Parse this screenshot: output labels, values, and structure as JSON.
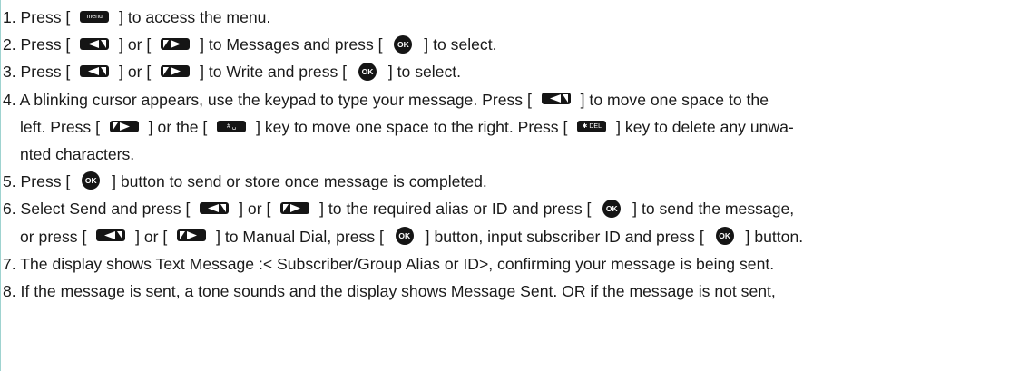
{
  "steps": [
    {
      "lines": [
        [
          {
            "t": "1. Press [ "
          },
          {
            "k": "menu"
          },
          {
            "t": " ] to access the menu."
          }
        ]
      ]
    },
    {
      "lines": [
        [
          {
            "t": "2. Press [ "
          },
          {
            "k": "left"
          },
          {
            "t": " ] or [ "
          },
          {
            "k": "right"
          },
          {
            "t": " ] to Messages and press [ "
          },
          {
            "k": "ok"
          },
          {
            "t": " ] to select."
          }
        ]
      ]
    },
    {
      "lines": [
        [
          {
            "t": "3. Press [ "
          },
          {
            "k": "left"
          },
          {
            "t": " ] or [ "
          },
          {
            "k": "right"
          },
          {
            "t": " ] to Write and press [ "
          },
          {
            "k": "ok"
          },
          {
            "t": " ] to select."
          }
        ]
      ]
    },
    {
      "lines": [
        [
          {
            "t": "4. A blinking cursor appears, use the keypad to type your message. Press [ "
          },
          {
            "k": "left"
          },
          {
            "t": " ] to move one space to the"
          }
        ],
        [
          {
            "t": "left. Press [ "
          },
          {
            "k": "right"
          },
          {
            "t": " ] or the [ "
          },
          {
            "k": "hash"
          },
          {
            "t": " ] key to move one space to the right. Press [ "
          },
          {
            "k": "del"
          },
          {
            "t": " ] key to delete any unwa-"
          }
        ],
        [
          {
            "t": "nted characters."
          }
        ]
      ]
    },
    {
      "lines": [
        [
          {
            "t": "5. Press [ "
          },
          {
            "k": "ok"
          },
          {
            "t": " ] button to send or store once message is completed."
          }
        ]
      ]
    },
    {
      "lines": [
        [
          {
            "t": "6. Select Send and press [ "
          },
          {
            "k": "left"
          },
          {
            "t": " ] or [ "
          },
          {
            "k": "right"
          },
          {
            "t": " ] to the required alias or ID and press [ "
          },
          {
            "k": "ok"
          },
          {
            "t": " ] to send the message,"
          }
        ],
        [
          {
            "t": "or press [ "
          },
          {
            "k": "left"
          },
          {
            "t": " ] or [ "
          },
          {
            "k": "right"
          },
          {
            "t": " ] to Manual Dial, press [ "
          },
          {
            "k": "ok"
          },
          {
            "t": " ] button, input subscriber ID and press [ "
          },
          {
            "k": "ok"
          },
          {
            "t": " ] button."
          }
        ]
      ]
    },
    {
      "lines": [
        [
          {
            "t": "7. The display shows Text Message :< Subscriber/Group Alias or ID>, confirming your message is being sent."
          }
        ]
      ]
    },
    {
      "lines": [
        [
          {
            "t": "8. If the message is sent, a tone sounds and the display shows Message Sent. OR if the message is not sent,"
          }
        ]
      ]
    }
  ],
  "keys": {
    "menu": {
      "name": "menu-key-icon",
      "label": "menu"
    },
    "left": {
      "name": "left-arrow-key-icon",
      "label": ""
    },
    "right": {
      "name": "right-arrow-key-icon",
      "label": ""
    },
    "ok": {
      "name": "ok-button-icon",
      "label": "OK"
    },
    "hash": {
      "name": "hash-space-key-icon",
      "label": "# ␣"
    },
    "del": {
      "name": "star-del-key-icon",
      "label": "✱ DEL"
    }
  },
  "colors": {
    "text": "#1a1a1a",
    "key": "#151515",
    "guide": "#9fd3d0"
  }
}
